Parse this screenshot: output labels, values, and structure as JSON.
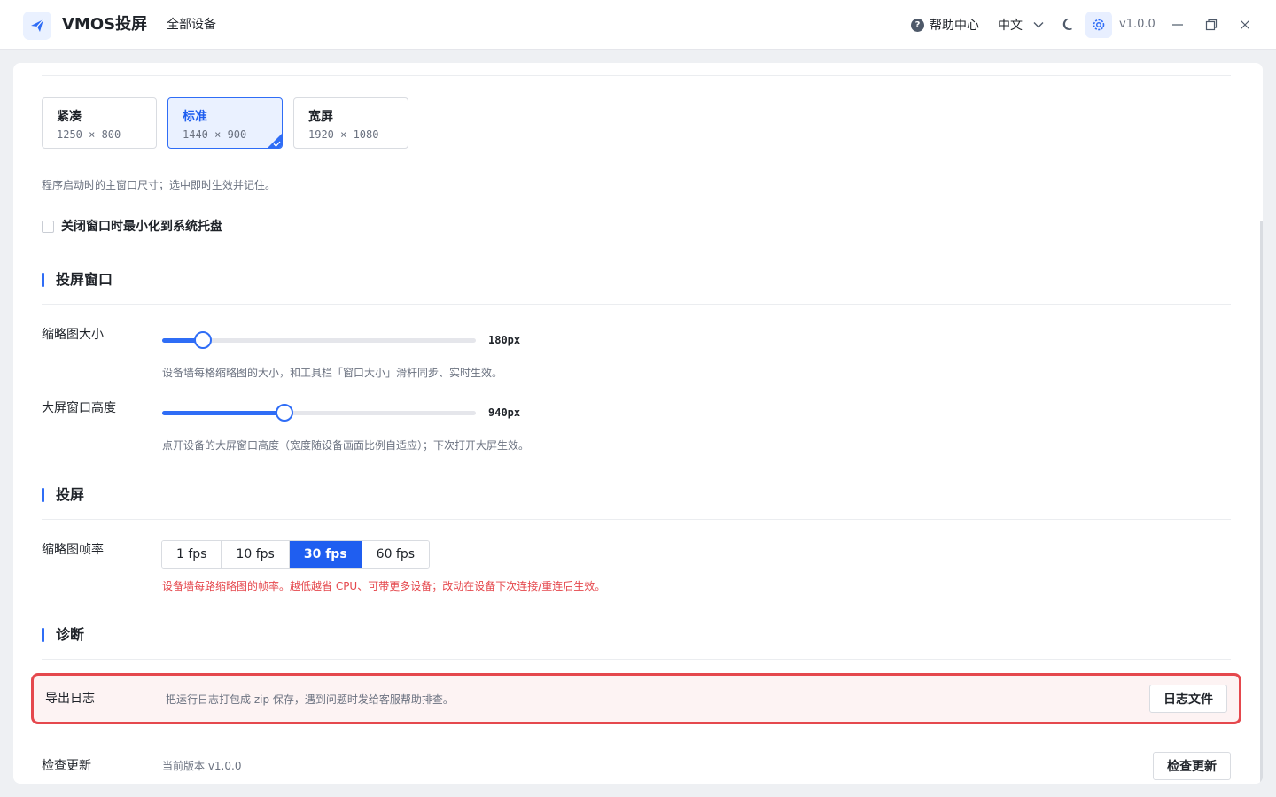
{
  "app": {
    "name": "VMOS投屏",
    "nav_all_devices": "全部设备"
  },
  "header": {
    "help": "帮助中心",
    "language": "中文",
    "version": "v1.0.0"
  },
  "window_size": {
    "options": [
      {
        "title": "紧凑",
        "size": "1250 × 800"
      },
      {
        "title": "标准",
        "size": "1440 × 900"
      },
      {
        "title": "宽屏",
        "size": "1920 × 1080"
      }
    ],
    "selected_index": 1,
    "hint": "程序启动时的主窗口尺寸；选中即时生效并记住。",
    "minimize_to_tray_label": "关闭窗口时最小化到系统托盘",
    "minimize_to_tray_checked": false
  },
  "cast_window": {
    "title": "投屏窗口",
    "thumbnail_size": {
      "label": "缩略图大小",
      "value_text": "180px",
      "fraction": 0.13,
      "hint": "设备墙每格缩略图的大小，和工具栏「窗口大小」滑杆同步、实时生效。"
    },
    "big_window_height": {
      "label": "大屏窗口高度",
      "value_text": "940px",
      "fraction": 0.39,
      "hint": "点开设备的大屏窗口高度（宽度随设备画面比例自适应）；下次打开大屏生效。"
    }
  },
  "cast": {
    "title": "投屏",
    "fps": {
      "label": "缩略图帧率",
      "options": [
        "1 fps",
        "10 fps",
        "30 fps",
        "60 fps"
      ],
      "selected_index": 2,
      "hint": "设备墙每路缩略图的帧率。越低越省 CPU、可带更多设备；改动在设备下次连接/重连后生效。"
    }
  },
  "diagnostics": {
    "title": "诊断",
    "export_log": {
      "label": "导出日志",
      "desc": "把运行日志打包成 zip 保存，遇到问题时发给客服帮助排查。",
      "button": "日志文件"
    },
    "check_update": {
      "label": "检查更新",
      "desc": "当前版本 v1.0.0",
      "button": "检查更新"
    }
  },
  "colors": {
    "accent": "#2f6df6",
    "highlight_border": "#e5484d",
    "highlight_bg": "#fdf3f3"
  }
}
